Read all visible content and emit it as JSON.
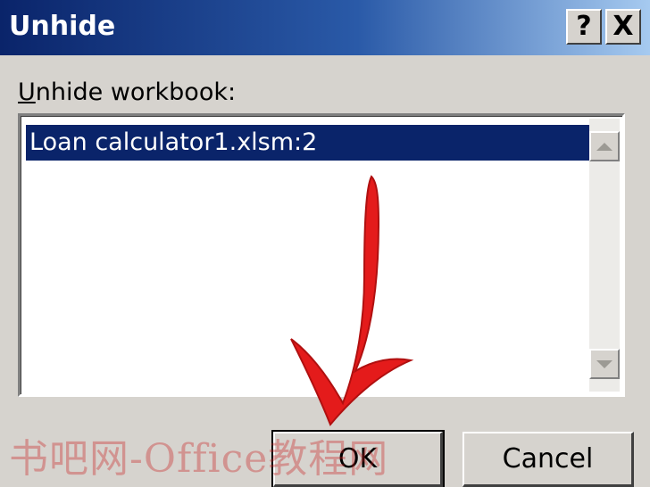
{
  "dialog": {
    "title": "Unhide",
    "help_label": "?",
    "close_label": "X"
  },
  "label": {
    "mnemonic": "U",
    "rest": "nhide workbook:"
  },
  "list": {
    "items": [
      {
        "label": "Loan calculator1.xlsm:2",
        "selected": true
      }
    ]
  },
  "buttons": {
    "ok": "OK",
    "cancel": "Cancel"
  },
  "overlay": {
    "arrow_color": "#e41b1b",
    "watermark": "书吧网-Office教程网"
  }
}
